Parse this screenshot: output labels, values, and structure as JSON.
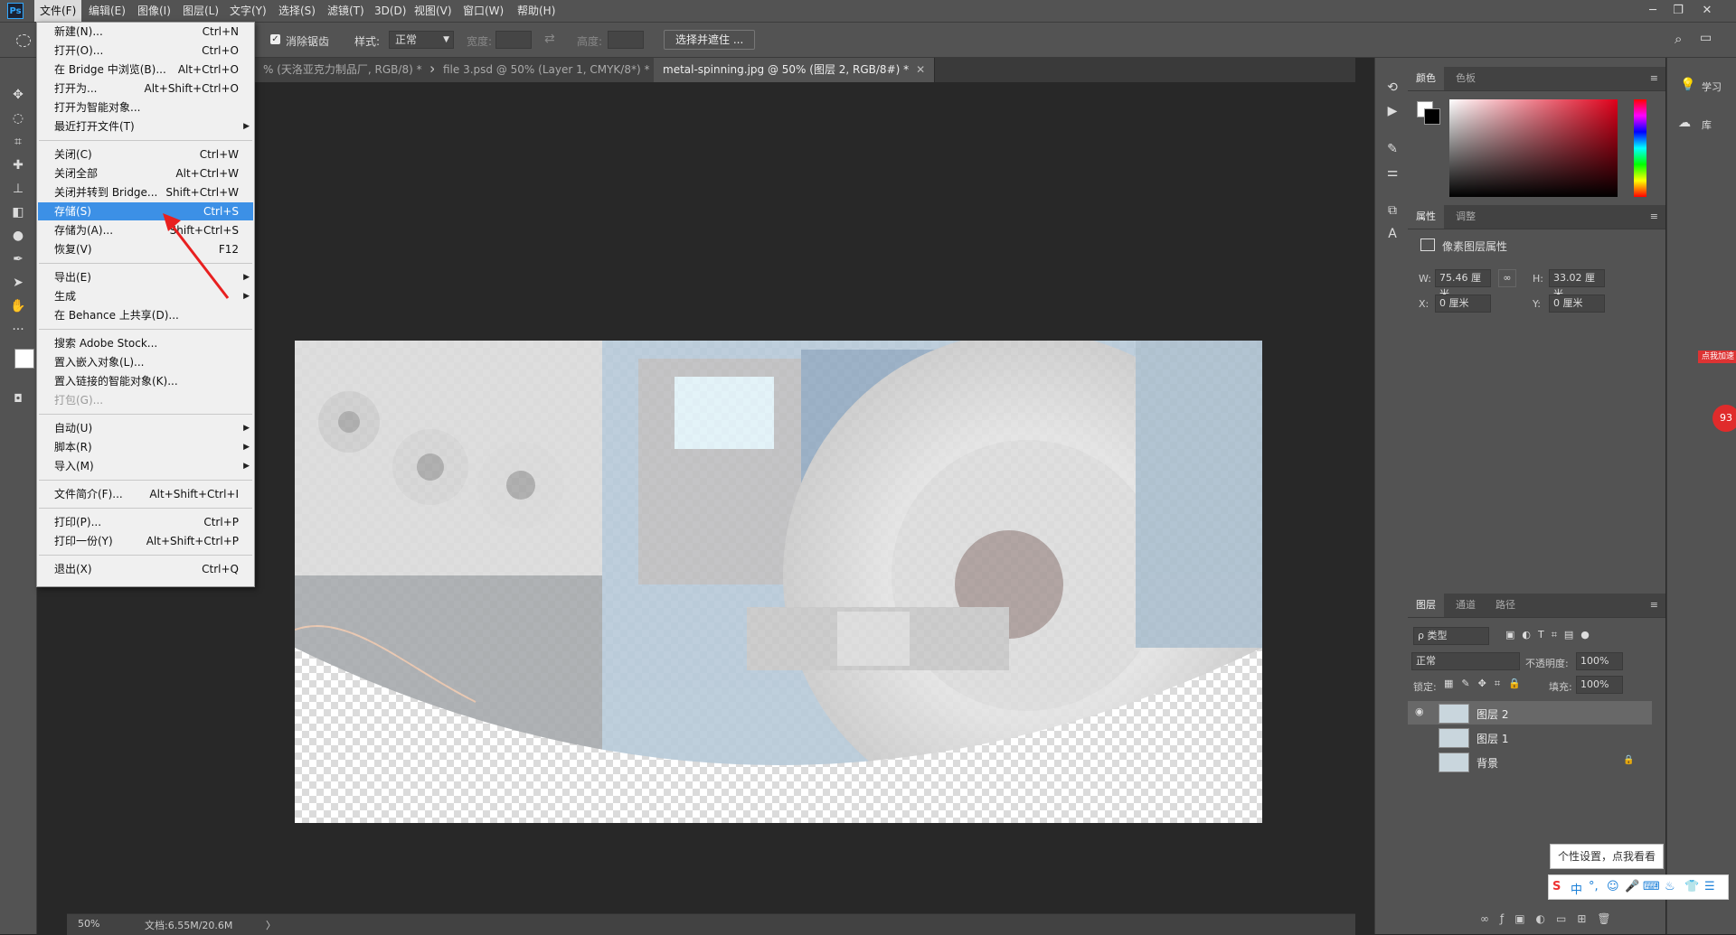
{
  "menubar": {
    "logo": "Ps",
    "items": [
      "文件(F)",
      "编辑(E)",
      "图像(I)",
      "图层(L)",
      "文字(Y)",
      "选择(S)",
      "滤镜(T)",
      "3D(D)",
      "视图(V)",
      "窗口(W)",
      "帮助(H)"
    ],
    "window_buttons": [
      "─",
      "❐",
      "✕"
    ]
  },
  "options": {
    "antialias_label": "消除锯齿",
    "style_label": "样式:",
    "style_value": "正常",
    "width_label": "宽度:",
    "height_label": "高度:",
    "select_mask_button": "选择并遮住 ..."
  },
  "tabs": [
    {
      "label": "% (天洛亚克力制品厂, RGB/8) *",
      "close": "✕"
    },
    {
      "label": "file 3.psd @ 50% (Layer 1, CMYK/8*) *",
      "close": "✕"
    },
    {
      "label": "metal-spinning.jpg @ 50% (图层 2, RGB/8#) *",
      "close": "✕"
    }
  ],
  "file_menu": {
    "items": [
      {
        "label": "新建(N)...",
        "shortcut": "Ctrl+N"
      },
      {
        "label": "打开(O)...",
        "shortcut": "Ctrl+O"
      },
      {
        "label": "在 Bridge 中浏览(B)...",
        "shortcut": "Alt+Ctrl+O"
      },
      {
        "label": "打开为...",
        "shortcut": "Alt+Shift+Ctrl+O"
      },
      {
        "label": "打开为智能对象...",
        "shortcut": ""
      },
      {
        "label": "最近打开文件(T)",
        "shortcut": ""
      },
      {
        "label": "关闭(C)",
        "shortcut": "Ctrl+W"
      },
      {
        "label": "关闭全部",
        "shortcut": "Alt+Ctrl+W"
      },
      {
        "label": "关闭并转到 Bridge...",
        "shortcut": "Shift+Ctrl+W"
      },
      {
        "label": "存储(S)",
        "shortcut": "Ctrl+S"
      },
      {
        "label": "存储为(A)...",
        "shortcut": "Shift+Ctrl+S"
      },
      {
        "label": "恢复(V)",
        "shortcut": "F12"
      },
      {
        "label": "导出(E)",
        "shortcut": ""
      },
      {
        "label": "生成",
        "shortcut": ""
      },
      {
        "label": "在 Behance 上共享(D)...",
        "shortcut": ""
      },
      {
        "label": "搜索 Adobe Stock...",
        "shortcut": ""
      },
      {
        "label": "置入嵌入对象(L)...",
        "shortcut": ""
      },
      {
        "label": "置入链接的智能对象(K)...",
        "shortcut": ""
      },
      {
        "label": "打包(G)...",
        "shortcut": ""
      },
      {
        "label": "自动(U)",
        "shortcut": ""
      },
      {
        "label": "脚本(R)",
        "shortcut": ""
      },
      {
        "label": "导入(M)",
        "shortcut": ""
      },
      {
        "label": "文件简介(F)...",
        "shortcut": "Alt+Shift+Ctrl+I"
      },
      {
        "label": "打印(P)...",
        "shortcut": "Ctrl+P"
      },
      {
        "label": "打印一份(Y)",
        "shortcut": "Alt+Shift+Ctrl+P"
      },
      {
        "label": "退出(X)",
        "shortcut": "Ctrl+Q"
      }
    ]
  },
  "status": {
    "zoom": "50%",
    "doc_info": "文档:6.55M/20.6M",
    "arrow": "〉"
  },
  "color_panel": {
    "tabs": [
      "颜色",
      "色板"
    ],
    "menu": "≡"
  },
  "properties_panel": {
    "tabs": [
      "属性",
      "调整"
    ],
    "title": "像素图层属性",
    "w_label": "W:",
    "w_value": "75.46 厘米",
    "h_label": "H:",
    "h_value": "33.02 厘米",
    "x_label": "X:",
    "x_value": "0 厘米",
    "y_label": "Y:",
    "y_value": "0 厘米"
  },
  "layers_panel": {
    "tabs": [
      "图层",
      "通道",
      "路径"
    ],
    "filter_value": "ρ 类型",
    "blend_mode": "正常",
    "opacity_label": "不透明度:",
    "opacity_value": "100%",
    "lock_label": "锁定:",
    "fill_label": "填充:",
    "fill_value": "100%",
    "layers": [
      {
        "name": "图层 2",
        "visible": true
      },
      {
        "name": "图层 1",
        "visible": false
      },
      {
        "name": "背景",
        "visible": false
      }
    ]
  },
  "learn_col": {
    "learn_label": "学习",
    "library_label": "库"
  },
  "ime": {
    "tip": "个性设置，点我看看",
    "lang": "中",
    "badge": "点我加速",
    "count": "93"
  },
  "colors": {
    "accent": "#3c90e6",
    "foreground": "#ffffff",
    "background": "#000000",
    "picker_hue": "#e0001a"
  }
}
